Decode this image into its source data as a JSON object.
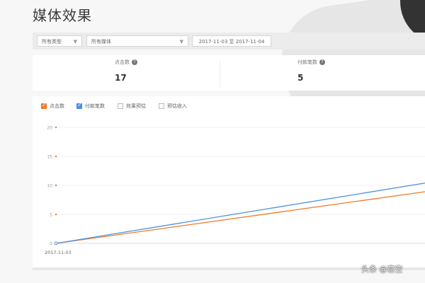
{
  "page": {
    "title": "媒体效果"
  },
  "filters": {
    "type_select": "所有类型",
    "media_select": "所有媒体",
    "date_range": "2017-11-03 至 2017-11-04"
  },
  "stats": [
    {
      "label": "点击数",
      "value": "17"
    },
    {
      "label": "付款笔数",
      "value": "5"
    }
  ],
  "legend": [
    {
      "label": "点击数",
      "checked": true,
      "color": "#f07a28"
    },
    {
      "label": "付款笔数",
      "checked": true,
      "color": "#4a90e2"
    },
    {
      "label": "效果预估",
      "checked": false
    },
    {
      "label": "预估收入",
      "checked": false
    }
  ],
  "chart_data": {
    "type": "line",
    "x": [
      "2017-11-03"
    ],
    "xlabel": "",
    "ylabel": "",
    "ylim": [
      0,
      20
    ],
    "yticks": [
      "0",
      "5",
      "10",
      "15",
      "20"
    ],
    "x_tick_labels": [
      "2017-11-03"
    ],
    "series": [
      {
        "name": "点击数",
        "color": "#f07a28",
        "points": [
          [
            0,
            0
          ],
          [
            1,
            8.9
          ]
        ]
      },
      {
        "name": "付款笔数",
        "color": "#4a90e2",
        "points": [
          [
            0,
            0
          ],
          [
            1,
            10.4
          ]
        ]
      }
    ],
    "grid": true
  },
  "watermark": "头条 @恋空"
}
